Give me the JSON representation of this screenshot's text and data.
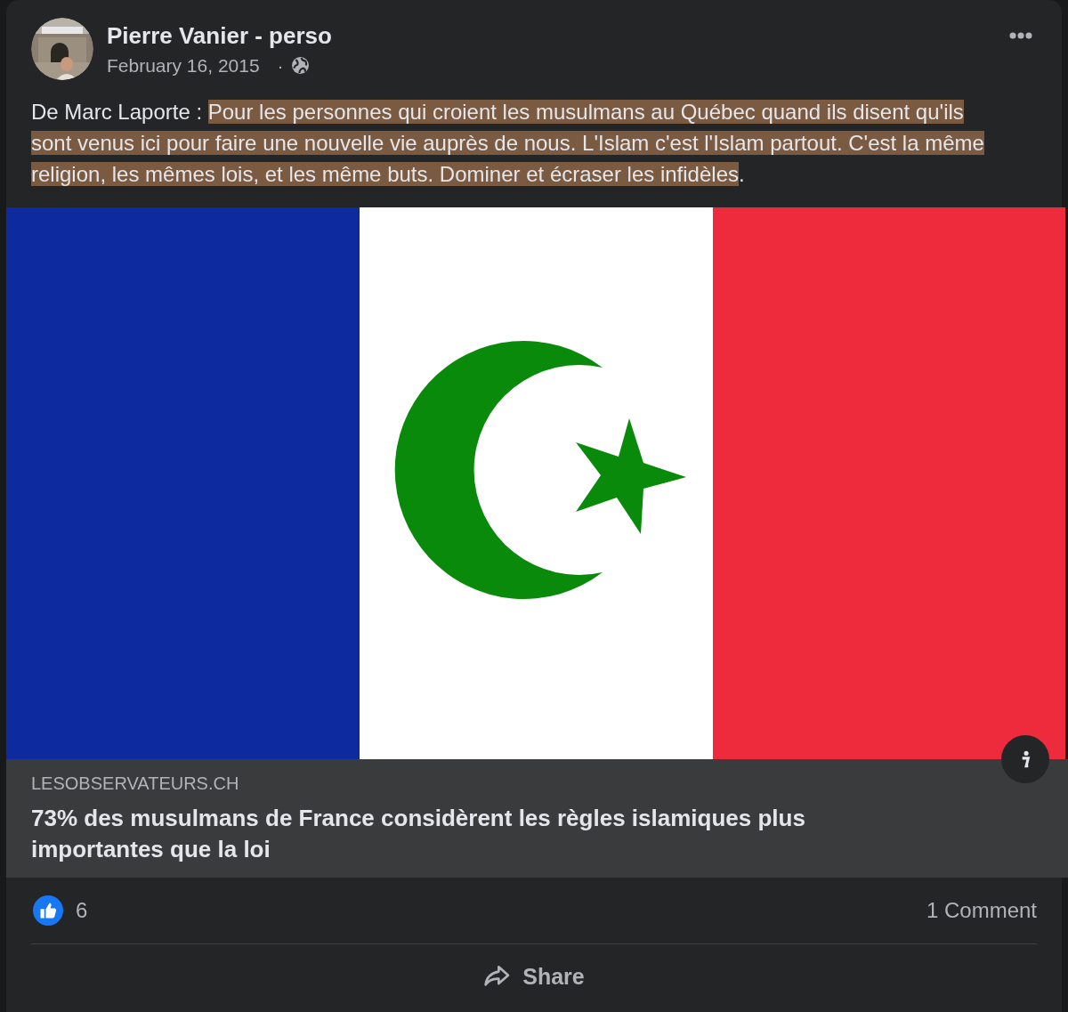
{
  "post": {
    "author": "Pierre Vanier - perso",
    "date": "February 16, 2015",
    "separator": "·",
    "text_prefix": "De Marc Laporte : ",
    "highlighted_text": "Pour les personnes qui croient les musulmans au Québec quand ils disent qu'ils sont venus ici pour faire une nouvelle vie auprès de nous. L'Islam c'est l'Islam partout. C'est la même religion, les mêmes lois, et les même buts. Dominer et écraser les infidèles",
    "text_suffix": "."
  },
  "link": {
    "domain": "LESOBSERVATEURS.CH",
    "headline": "73% des musulmans de France considèrent les règles islamiques plus importantes que la loi"
  },
  "stats": {
    "likes": "6",
    "comments": "1 Comment"
  },
  "actions": [
    {
      "kind": "share",
      "label": "Share"
    }
  ]
}
